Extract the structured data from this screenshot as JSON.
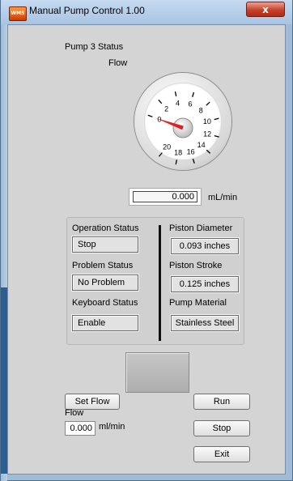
{
  "window": {
    "title": "Manual Pump Control  1.00",
    "icon_label": "WMS",
    "close_symbol": "x"
  },
  "header": {
    "pump_status_label": "Pump 3 Status",
    "flow_label": "Flow"
  },
  "gauge": {
    "ticks": [
      "0",
      "2",
      "4",
      "6",
      "8",
      "10",
      "12",
      "14",
      "16",
      "18",
      "20"
    ],
    "value": 0,
    "min": 0,
    "max": 20,
    "needle_color": "#e02020"
  },
  "flow_readout": {
    "value": "0.000",
    "unit": "mL/min"
  },
  "status": {
    "operation_label": "Operation Status",
    "operation_value": "Stop",
    "problem_label": "Problem Status",
    "problem_value": "No Problem",
    "keyboard_label": "Keyboard Status",
    "keyboard_value": "Enable"
  },
  "specs": {
    "diameter_label": "Piston Diameter",
    "diameter_value": "0.093 inches",
    "stroke_label": "Piston Stroke",
    "stroke_value": "0.125 inches",
    "material_label": "Pump Material",
    "material_value": "Stainless Steel"
  },
  "controls": {
    "set_flow_label": "Set Flow",
    "flow_label": "Flow",
    "flow_input_value": "0.000",
    "flow_unit": "ml/min",
    "run_label": "Run",
    "stop_label": "Stop",
    "exit_label": "Exit"
  }
}
